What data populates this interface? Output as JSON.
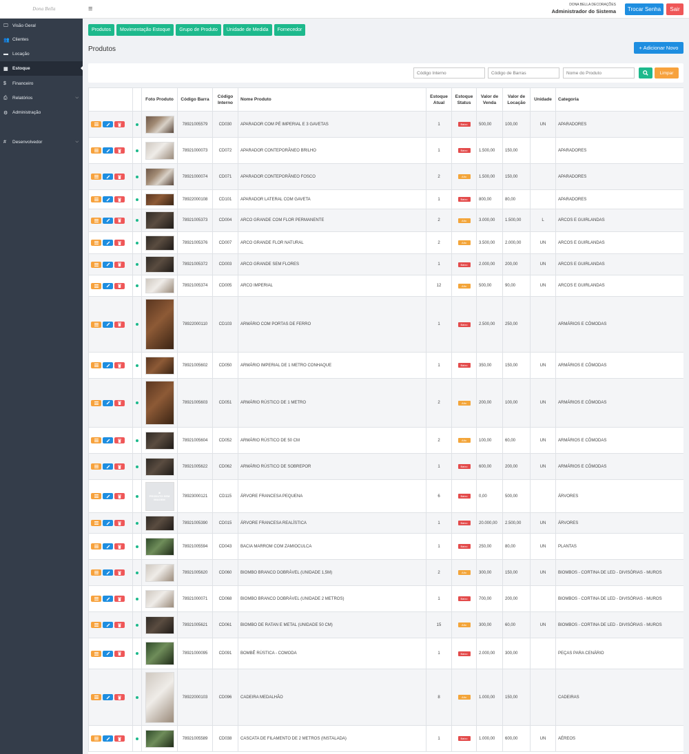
{
  "header": {
    "logo_text": "Dona Bella",
    "company": "DONA BELLA DECORAÇÕES",
    "user_role": "Administrador do Sistema",
    "change_password": "Trocar Senha",
    "logout": "Sair"
  },
  "sidebar": {
    "items": [
      {
        "label": "Visão Geral",
        "icon": "monitor-icon"
      },
      {
        "label": "Clientes",
        "icon": "users-icon"
      },
      {
        "label": "Locação",
        "icon": "box-icon"
      },
      {
        "label": "Estoque",
        "icon": "grid-icon"
      },
      {
        "label": "Financeiro",
        "icon": "dollar-icon"
      },
      {
        "label": "Relatórios",
        "icon": "printer-icon"
      },
      {
        "label": "Administração",
        "icon": "gear-icon"
      },
      {
        "label": "Desenvolvedor",
        "icon": "hash-icon"
      }
    ]
  },
  "subnav": [
    "Produtos",
    "Movimentação Estoque",
    "Grupo de Produto",
    "Unidade de Medida",
    "Fornecedor"
  ],
  "page": {
    "title": "Produtos",
    "add_button": "+ Adicionar Novo"
  },
  "filters": {
    "internal_code": "Código Interno",
    "barcode": "Código de Barras",
    "product_name": "Nome do Produto",
    "clear": "Limpar"
  },
  "table": {
    "headers": {
      "photo": "Foto Produto",
      "barcode": "Código Barra",
      "internal": "Código Interno",
      "name": "Nome Produto",
      "stock": "Estoque Atual",
      "status": "Estoque Status",
      "sale": "Valor de Venda",
      "rent": "Valor de Locação",
      "unit": "Unidade",
      "category": "Categoria"
    },
    "no_image_text": "PRODUTO SEM IMAGEM",
    "rows": [
      {
        "barcode": "78921005579",
        "code": "CD030",
        "name": "APARADOR COM PÉ IMPERIAL E 3 GAVETAS",
        "stock": "1",
        "status": "Baixo",
        "sale": "500,00",
        "rent": "100,00",
        "unit": "UN",
        "category": "APARADORES"
      },
      {
        "barcode": "78921000073",
        "code": "CD072",
        "name": "APARADOR CONTEPORÂNEO BRILHO",
        "stock": "1",
        "status": "Baixo",
        "sale": "1.500,00",
        "rent": "150,00",
        "unit": "",
        "category": "APARADORES"
      },
      {
        "barcode": "78921000074",
        "code": "CD071",
        "name": "APARADOR CONTEPORÂNEO FOSCO",
        "stock": "2",
        "status": "Alto",
        "sale": "1.500,00",
        "rent": "150,00",
        "unit": "",
        "category": "APARADORES"
      },
      {
        "barcode": "78922000108",
        "code": "CD101",
        "name": "APARADOR LATERAL COM GAVETA",
        "stock": "1",
        "status": "Baixo",
        "sale": "800,00",
        "rent": "80,00",
        "unit": "",
        "category": "APARADORES"
      },
      {
        "barcode": "78921005373",
        "code": "CD004",
        "name": "ARCO GRANDE COM FLOR PERMANENTE",
        "stock": "2",
        "status": "Alto",
        "sale": "3.000,00",
        "rent": "1.500,00",
        "unit": "L",
        "category": "ARCOS E GUIRLANDAS"
      },
      {
        "barcode": "78921005376",
        "code": "CD007",
        "name": "ARCO GRANDE FLOR NATURAL",
        "stock": "2",
        "status": "Alto",
        "sale": "3.500,00",
        "rent": "2.000,00",
        "unit": "UN",
        "category": "ARCOS E GUIRLANDAS"
      },
      {
        "barcode": "78921005372",
        "code": "CD003",
        "name": "ARCO GRANDE SEM FLORES",
        "stock": "1",
        "status": "Baixo",
        "sale": "2.000,00",
        "rent": "200,00",
        "unit": "UN",
        "category": "ARCOS E GUIRLANDAS"
      },
      {
        "barcode": "78921005374",
        "code": "CD005",
        "name": "ARCO IMPERIAL",
        "stock": "12",
        "status": "Alto",
        "sale": "500,00",
        "rent": "90,00",
        "unit": "UN",
        "category": "ARCOS E GUIRLANDAS"
      },
      {
        "barcode": "78922000110",
        "code": "CD103",
        "name": "ARMÁRIO COM PORTAS DE FERRO",
        "stock": "1",
        "status": "Baixo",
        "sale": "2.500,00",
        "rent": "250,00",
        "unit": "",
        "category": "ARMÁRIOS E CÔMODAS"
      },
      {
        "barcode": "78921005602",
        "code": "CD050",
        "name": "ARMÁRIO IMPERIAL DE 1 METRO CONHAQUE",
        "stock": "1",
        "status": "Baixo",
        "sale": "350,00",
        "rent": "150,00",
        "unit": "UN",
        "category": "ARMÁRIOS E CÔMODAS"
      },
      {
        "barcode": "78921005603",
        "code": "CD051",
        "name": "ARMÁRIO RÚSTICO DE 1 METRO",
        "stock": "2",
        "status": "Alto",
        "sale": "200,00",
        "rent": "100,00",
        "unit": "UN",
        "category": "ARMÁRIOS E CÔMODAS"
      },
      {
        "barcode": "78921005604",
        "code": "CD052",
        "name": "ARMÁRIO RÚSTICO DE 50 CM",
        "stock": "2",
        "status": "Alto",
        "sale": "100,00",
        "rent": "60,00",
        "unit": "UN",
        "category": "ARMÁRIOS E CÔMODAS"
      },
      {
        "barcode": "78921005622",
        "code": "CD062",
        "name": "ARMÁRIO RÚSTICO DE SOBREPOR",
        "stock": "1",
        "status": "Baixo",
        "sale": "600,00",
        "rent": "200,00",
        "unit": "UN",
        "category": "ARMÁRIOS E CÔMODAS"
      },
      {
        "barcode": "78923000121",
        "code": "CD115",
        "name": "ÁRVORE FRANCESA PEQUENA",
        "stock": "6",
        "status": "Baixo",
        "sale": "0,00",
        "rent": "500,00",
        "unit": "",
        "category": "ÁRVORES"
      },
      {
        "barcode": "78921005390",
        "code": "CD015",
        "name": "ÁRVORE FRANCESA REALÍSTICA",
        "stock": "1",
        "status": "Baixo",
        "sale": "20.000,00",
        "rent": "2.500,00",
        "unit": "UN",
        "category": "ÁRVORES"
      },
      {
        "barcode": "78921005594",
        "code": "CD043",
        "name": "BACIA MARROM COM ZAMIOCULCA",
        "stock": "1",
        "status": "Baixo",
        "sale": "250,00",
        "rent": "80,00",
        "unit": "UN",
        "category": "PLANTAS"
      },
      {
        "barcode": "78921005620",
        "code": "CD060",
        "name": "BIOMBO BRANCO DOBRÁVEL (UNIDADE 1,5M)",
        "stock": "2",
        "status": "Alto",
        "sale": "300,00",
        "rent": "150,00",
        "unit": "UN",
        "category": "BIOMBOS - CORTINA DE LED - DIVISÓRIAS - MUROS"
      },
      {
        "barcode": "78921000071",
        "code": "CD068",
        "name": "BIOMBO BRANCO DOBRÁVEL (UNIDADE 2 METROS)",
        "stock": "1",
        "status": "Baixo",
        "sale": "700,00",
        "rent": "200,00",
        "unit": "",
        "category": "BIOMBOS - CORTINA DE LED - DIVISÓRIAS - MUROS"
      },
      {
        "barcode": "78921005621",
        "code": "CD061",
        "name": "BIOMBO DE RATAN E METAL (UNIDADE 50 CM)",
        "stock": "15",
        "status": "Alto",
        "sale": "300,00",
        "rent": "60,00",
        "unit": "UN",
        "category": "BIOMBOS - CORTINA DE LED - DIVISÓRIAS - MUROS"
      },
      {
        "barcode": "78921000095",
        "code": "CD091",
        "name": "BOMBÊ RÚSTICA - COMODA",
        "stock": "1",
        "status": "Baixo",
        "sale": "2.000,00",
        "rent": "300,00",
        "unit": "",
        "category": "PEÇAS PARA CENÁRIO"
      },
      {
        "barcode": "78922000103",
        "code": "CD096",
        "name": "CADEIRA MEDALHÃO",
        "stock": "8",
        "status": "Alto",
        "sale": "1.000,00",
        "rent": "150,00",
        "unit": "",
        "category": "CADEIRAS"
      },
      {
        "barcode": "78921005589",
        "code": "CD038",
        "name": "CASCATA DE FILAMENTO DE 2 METROS (INSTALADA)",
        "stock": "1",
        "status": "Baixo",
        "sale": "1.000,00",
        "rent": "600,00",
        "unit": "UN",
        "category": "AÉREOS"
      }
    ]
  },
  "colors": {
    "sidebar": "#343d4a",
    "green": "#1db98c",
    "blue": "#1e8ee0",
    "red": "#ef5758",
    "orange": "#f7a23d"
  }
}
